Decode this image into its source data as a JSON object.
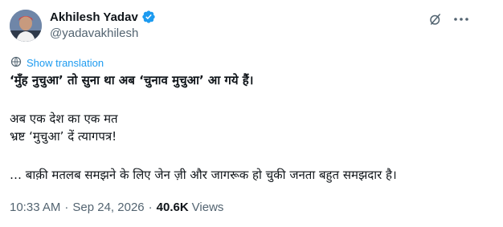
{
  "author": {
    "name": "Akhilesh Yadav",
    "handle": "@yadavakhilesh"
  },
  "icons": {
    "avatar": "avatar",
    "verified": "verified-badge-icon",
    "grok": "grok-icon",
    "more": "more-icon",
    "translate": "translate-icon"
  },
  "colors": {
    "accent": "#1d9bf0",
    "secondary_text": "#536471",
    "primary_text": "#0f1419"
  },
  "translation": {
    "label": "Show translation"
  },
  "tweet": {
    "line1": "‘मुँह नुचुआ’ तो सुना था अब ‘चुनाव मुचुआ’ आ गये हैं।",
    "line2": "अब एक देश का एक मत",
    "line3": "भ्रष्ट ‘मुचुआ’ दें त्यागपत्र!",
    "line4": "… बाक़ी मतलब समझने के लिए जेन ज़ी और जागरूक हो चुकी जनता बहुत समझदार है।"
  },
  "meta": {
    "time": "10:33 AM",
    "separator": "·",
    "date": "Sep 24, 2026",
    "views_count": "40.6K",
    "views_label": "Views"
  }
}
